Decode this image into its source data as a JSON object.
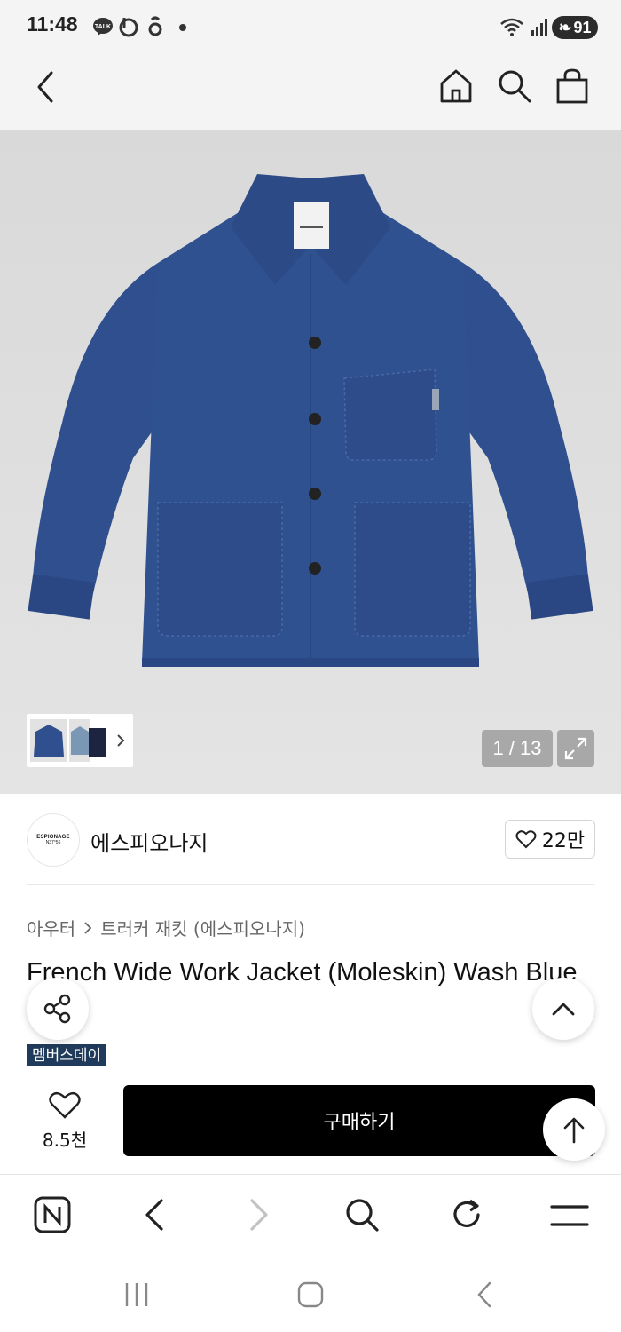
{
  "status_bar": {
    "time": "11:48",
    "talk_badge": "TALK",
    "battery": "91"
  },
  "header": {
    "back_icon": "chevron-left-icon",
    "home_icon": "home-icon",
    "search_icon": "search-icon",
    "cart_icon": "shopping-bag-icon"
  },
  "gallery": {
    "counter": "1 / 13",
    "expand_icon": "expand-icon",
    "jacket_color": "#2f4f8f"
  },
  "brand": {
    "logo_line1": "ESPIONAGE",
    "logo_line2": "N37°56",
    "name": "에스피오나지",
    "likes": "22만"
  },
  "breadcrumb": {
    "category": "아우터",
    "subcategory": "트러커 재킷 (에스피오나지)"
  },
  "product": {
    "title": "French Wide Work Jacket (Moleskin) Wash Blue",
    "badge": "멤버스데이"
  },
  "purchase_bar": {
    "wish_count": "8.5천",
    "buy_label": "구매하기"
  },
  "browser_bar": {
    "icons": [
      "n-logo-icon",
      "back-icon",
      "forward-icon",
      "search-icon",
      "refresh-icon",
      "menu-icon"
    ]
  },
  "colors": {
    "buy_button": "#000000",
    "badge_bg": "#1f3a5a",
    "image_bg": "#dcdcdc"
  }
}
